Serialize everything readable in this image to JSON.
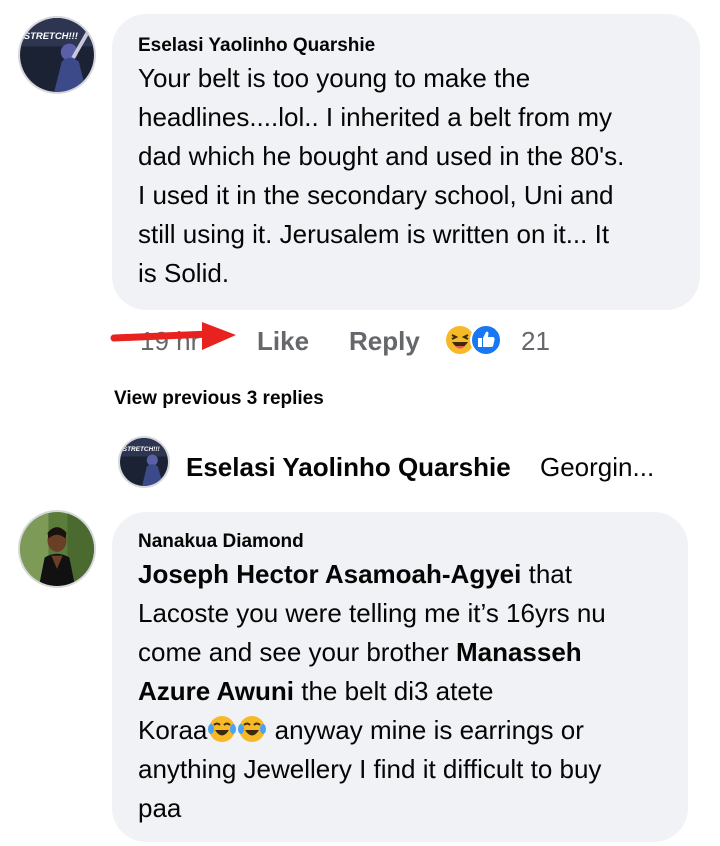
{
  "comment1": {
    "author": "Eselasi Yaolinho Quarshie",
    "avatar_text": "STRETCH!!!",
    "text": "Your belt is too young to make the headlines....lol.. I inherited a belt from my dad which he bought and used in the 80's. I used it in the secondary school, Uni and still using it. Jerusalem is written on it... It is Solid.",
    "lines": [
      "Your belt is too young to make the",
      "headlines....lol.. I inherited a belt from my",
      "dad which he bought and used in the 80's.",
      "I used it in the secondary school, Uni and",
      "still using it. Jerusalem is written on it... It",
      "is Solid."
    ]
  },
  "actions": {
    "time": "19 hr",
    "like_label": "Like",
    "reply_label": "Reply",
    "reaction_count": "21",
    "reactions": [
      "laughing-emoji",
      "like-thumb"
    ]
  },
  "view_previous": "View previous 3 replies",
  "reply_preview": {
    "author": "Eselasi Yaolinho Quarshie",
    "snippet": "Georgin..."
  },
  "comment2": {
    "author": "Nanakua Diamond",
    "mention1": "Joseph Hector Asamoah-Agyei",
    "line1_rest": " that",
    "line2": "Lacoste you were telling me it’s 16yrs nu",
    "line3_pre": "come and see your brother ",
    "mention2_a": "Manasseh",
    "mention2_b": "Azure Awuni",
    "line4_rest": " the belt di3 atete",
    "line5_pre": "Koraa",
    "line5_post": " anyway mine is earrings or",
    "line6": "anything Jewellery I find it difficult to buy",
    "line7": "paa"
  },
  "colors": {
    "bubble_bg": "#f0f2f5",
    "action_text": "#65676b",
    "arrow_red": "#e8231f",
    "like_blue": "#1877f2",
    "haha_yellow": "#f7b928"
  }
}
